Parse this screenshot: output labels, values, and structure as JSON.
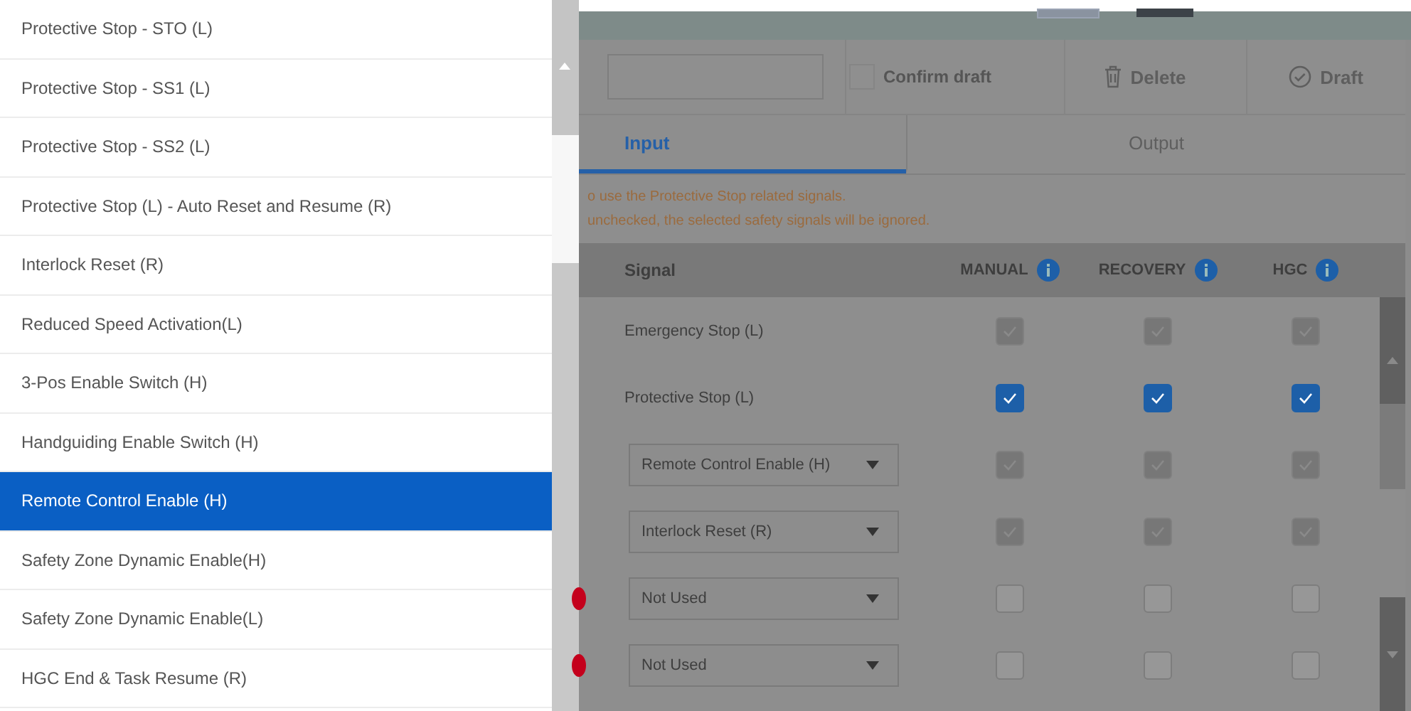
{
  "dropdown": {
    "items": [
      {
        "label": "Protective Stop - STO (L)",
        "selected": false
      },
      {
        "label": "Protective Stop - SS1 (L)",
        "selected": false
      },
      {
        "label": "Protective Stop - SS2 (L)",
        "selected": false
      },
      {
        "label": "Protective Stop (L) - Auto Reset and Resume (R)",
        "selected": false
      },
      {
        "label": "Interlock Reset (R)",
        "selected": false
      },
      {
        "label": "Reduced Speed Activation(L)",
        "selected": false
      },
      {
        "label": "3-Pos Enable Switch (H)",
        "selected": false
      },
      {
        "label": "Handguiding Enable Switch (H)",
        "selected": false
      },
      {
        "label": "Remote Control Enable (H)",
        "selected": true
      },
      {
        "label": "Safety Zone Dynamic Enable(H)",
        "selected": false
      },
      {
        "label": "Safety Zone Dynamic Enable(L)",
        "selected": false
      },
      {
        "label": "HGC End & Task Resume (R)",
        "selected": false
      }
    ]
  },
  "toolbar": {
    "confirm_draft": {
      "label": "Confirm draft",
      "checked": false
    },
    "buttons": [
      {
        "kind": "trash",
        "label": "Delete"
      },
      {
        "kind": "check-circle",
        "label": "Draft"
      }
    ]
  },
  "tabs": [
    {
      "label": "Input",
      "selected": true
    },
    {
      "label": "Output",
      "selected": false
    }
  ],
  "notice": [
    "o use the Protective Stop related signals.",
    "unchecked, the selected safety signals will be ignored."
  ],
  "table": {
    "columns": [
      "Signal",
      "MANUAL",
      "RECOVERY",
      "HGC"
    ],
    "rows": [
      {
        "kind": "text",
        "signal": "Emergency Stop (L)",
        "alert": false,
        "checks": [
          {
            "checked": true,
            "disabled": true
          },
          {
            "checked": true,
            "disabled": true
          },
          {
            "checked": true,
            "disabled": true
          }
        ]
      },
      {
        "kind": "text",
        "signal": "Protective Stop (L)",
        "alert": false,
        "checks": [
          {
            "checked": true,
            "disabled": false
          },
          {
            "checked": true,
            "disabled": false
          },
          {
            "checked": true,
            "disabled": false
          }
        ]
      },
      {
        "kind": "select",
        "signal": "Remote Control Enable (H)",
        "alert": false,
        "checks": [
          {
            "checked": true,
            "disabled": true
          },
          {
            "checked": true,
            "disabled": true
          },
          {
            "checked": true,
            "disabled": true
          }
        ]
      },
      {
        "kind": "select",
        "signal": "Interlock Reset (R)",
        "alert": false,
        "checks": [
          {
            "checked": true,
            "disabled": true
          },
          {
            "checked": true,
            "disabled": true
          },
          {
            "checked": true,
            "disabled": true
          }
        ]
      },
      {
        "kind": "select",
        "signal": "Not Used",
        "alert": true,
        "checks": [
          {
            "checked": false,
            "disabled": true
          },
          {
            "checked": false,
            "disabled": true
          },
          {
            "checked": false,
            "disabled": true
          }
        ]
      },
      {
        "kind": "select",
        "signal": "Not Used",
        "alert": true,
        "checks": [
          {
            "checked": false,
            "disabled": true
          },
          {
            "checked": false,
            "disabled": true
          },
          {
            "checked": false,
            "disabled": true
          }
        ]
      }
    ]
  }
}
